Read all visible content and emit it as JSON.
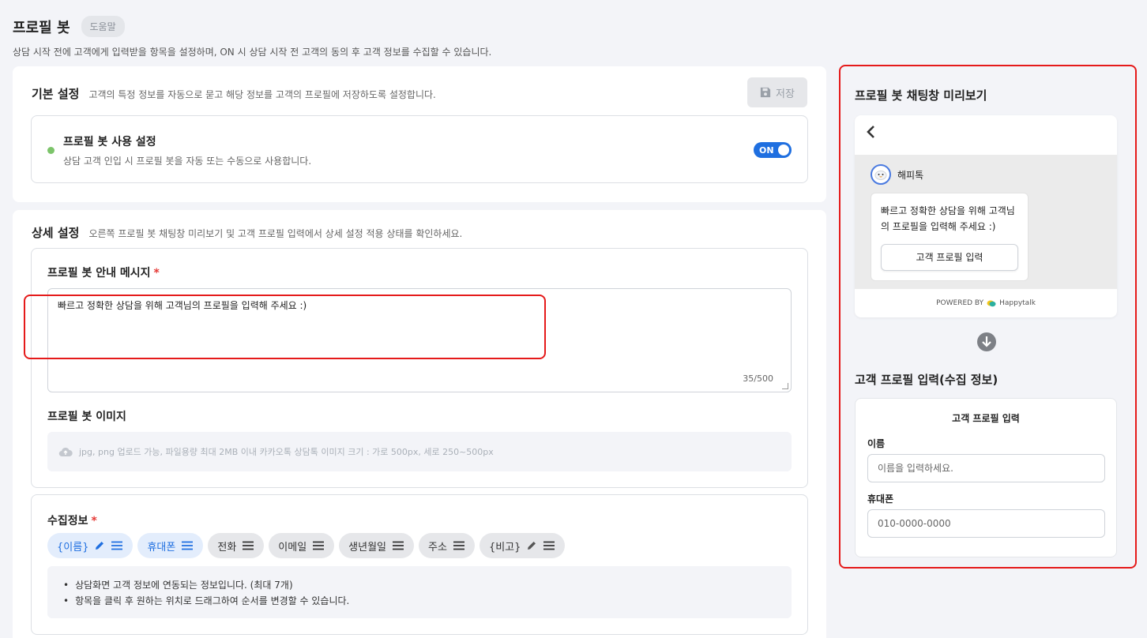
{
  "header": {
    "title": "프로필 봇",
    "help_label": "도움말",
    "description": "상담 시작 전에 고객에게 입력받을 항목을 설정하며, ON 시 상담 시작 전 고객의 동의 후 고객 정보를 수집할 수 있습니다."
  },
  "basic": {
    "title": "기본 설정",
    "desc": "고객의 특정 정보를 자동으로 묻고 해당 정보를 고객의 프로필에 저장하도록 설정합니다.",
    "save_label": "저장",
    "use_title": "프로필 봇 사용 설정",
    "use_desc": "상담 고객 인입 시 프로필 봇을 자동 또는 수동으로 사용합니다.",
    "toggle_label": "ON"
  },
  "detail": {
    "title": "상세 설정",
    "desc": "오른쪽 프로필 봇 채팅창 미리보기 및 고객 프로필 입력에서 상세 설정 적용 상태를 확인하세요.",
    "message_label": "프로필 봇 안내 메시지",
    "required_mark": "*",
    "message_value": "빠르고 정확한 상담을 위해 고객님의 프로필을 입력해 주세요 :)",
    "message_count": "35/500",
    "image_label": "프로필 봇 이미지",
    "image_hint": "jpg, png 업로드 가능, 파일용량 최대 2MB 이내 카카오톡 상담톡 이미지 크기 : 가로 500px, 세로 250~500px",
    "collect_label": "수집정보",
    "chips": [
      {
        "label": "{이름}",
        "active": true,
        "editable": true
      },
      {
        "label": "휴대폰",
        "active": true,
        "editable": false
      },
      {
        "label": "전화",
        "active": false,
        "editable": false
      },
      {
        "label": "이메일",
        "active": false,
        "editable": false
      },
      {
        "label": "생년월일",
        "active": false,
        "editable": false
      },
      {
        "label": "주소",
        "active": false,
        "editable": false
      },
      {
        "label": "{비고}",
        "active": false,
        "editable": true
      }
    ],
    "notes": [
      "상담화면 고객 정보에 연동되는 정보입니다. (최대 7개)",
      "항목을 클릭 후 원하는 위치로 드래그하여 순서를 변경할 수 있습니다."
    ]
  },
  "preview": {
    "title": "프로필 봇 채팅창 미리보기",
    "bot_name": "해피톡",
    "bubble_text": "빠르고 정확한 상담을 위해 고객님의 프로필을 입력해 주세요 :)",
    "bubble_button": "고객 프로필 입력",
    "powered_by": "POWERED BY",
    "brand": "Happytalk",
    "form_section_title": "고객 프로필 입력(수집 정보)",
    "form_title": "고객 프로필 입력",
    "name_label": "이름",
    "name_placeholder": "이름을 입력하세요.",
    "phone_label": "휴대폰",
    "phone_placeholder": "010-0000-0000"
  },
  "colors": {
    "accent": "#1f6fe0",
    "highlight_border": "#e51a1a",
    "status_green": "#7cc46a"
  }
}
